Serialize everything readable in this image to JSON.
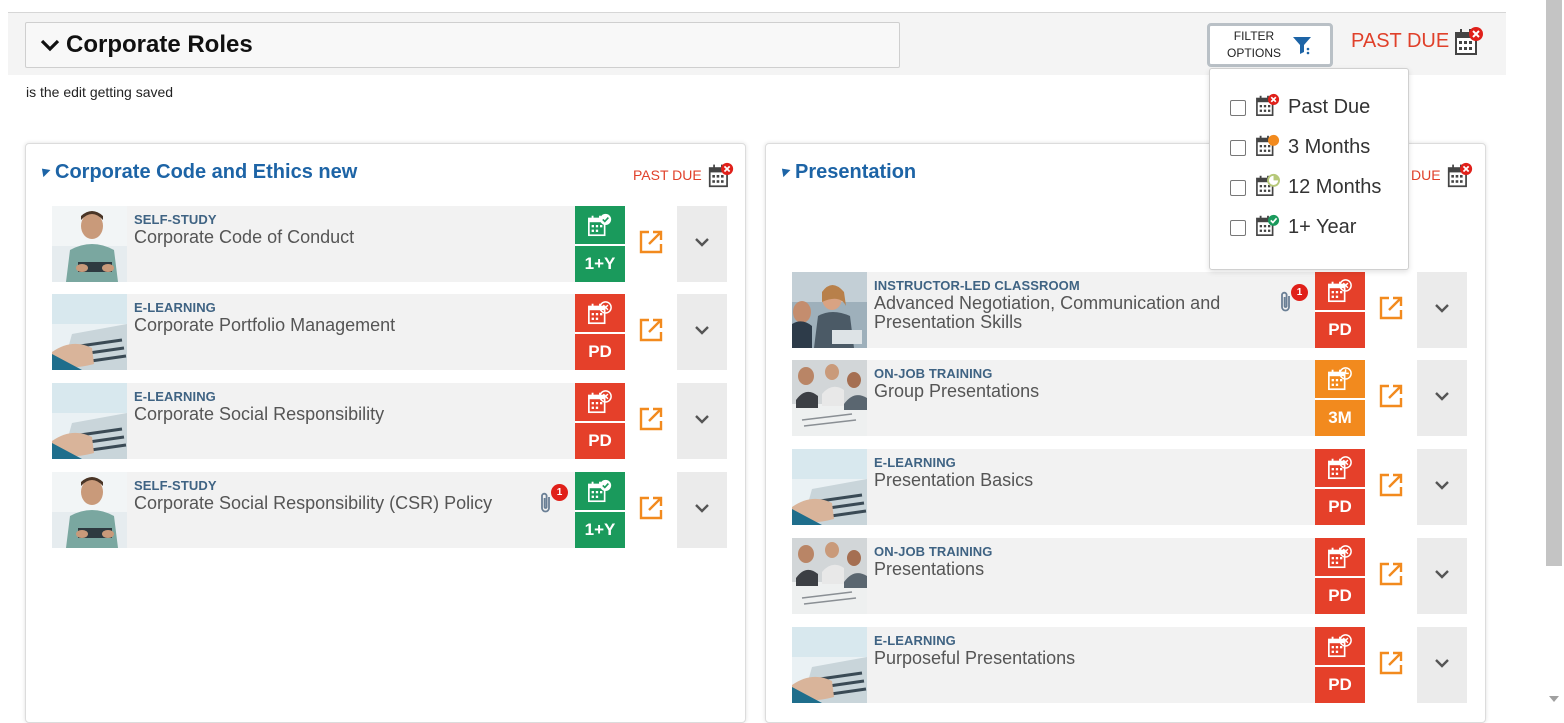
{
  "header": {
    "title": "Corporate Roles",
    "filter_label": "FILTER OPTIONS",
    "past_due": "PAST DUE",
    "note": "is the edit getting saved"
  },
  "filter_options": [
    {
      "label": "Past Due",
      "icon": "calendar-past-due-icon",
      "checked": false
    },
    {
      "label": "3 Months",
      "icon": "calendar-3-months-icon",
      "checked": false
    },
    {
      "label": "12 Months",
      "icon": "calendar-12-months-icon",
      "checked": false
    },
    {
      "label": "1+ Year",
      "icon": "calendar-1-year-icon",
      "checked": false
    }
  ],
  "panels": [
    {
      "title": "Corporate Code and Ethics new",
      "past_due": "PAST DUE",
      "courses": [
        {
          "type": "SELF-STUDY",
          "name": "Corporate Code of Conduct",
          "status": "1+Y",
          "status_color": "#1a9a5c",
          "attachments": null
        },
        {
          "type": "E-LEARNING",
          "name": "Corporate Portfolio Management",
          "status": "PD",
          "status_color": "#e5402a",
          "attachments": null
        },
        {
          "type": "E-LEARNING",
          "name": "Corporate Social Responsibility",
          "status": "PD",
          "status_color": "#e5402a",
          "attachments": null
        },
        {
          "type": "SELF-STUDY",
          "name": "Corporate Social Responsibility (CSR) Policy",
          "status": "1+Y",
          "status_color": "#1a9a5c",
          "attachments": "1"
        }
      ]
    },
    {
      "title": "Presentation",
      "past_due": "DUE",
      "courses": [
        {
          "type": "INSTRUCTOR-LED CLASSROOM",
          "name": "Advanced Negotiation, Communication and Presentation Skills",
          "status": "PD",
          "status_color": "#e5402a",
          "attachments": "1"
        },
        {
          "type": "ON-JOB TRAINING",
          "name": "Group Presentations",
          "status": "3M",
          "status_color": "#f28a1e",
          "attachments": null
        },
        {
          "type": "E-LEARNING",
          "name": "Presentation Basics",
          "status": "PD",
          "status_color": "#e5402a",
          "attachments": null
        },
        {
          "type": "ON-JOB TRAINING",
          "name": "Presentations",
          "status": "PD",
          "status_color": "#e5402a",
          "attachments": null
        },
        {
          "type": "E-LEARNING",
          "name": "Purposeful Presentations",
          "status": "PD",
          "status_color": "#e5402a",
          "attachments": null
        }
      ]
    }
  ],
  "colors": {
    "accent_blue": "#1d64a6",
    "past_due_red": "#e5402a",
    "three_month_orange": "#f28a1e",
    "one_year_green": "#1a9a5c",
    "launch_orange": "#f28a1e"
  }
}
